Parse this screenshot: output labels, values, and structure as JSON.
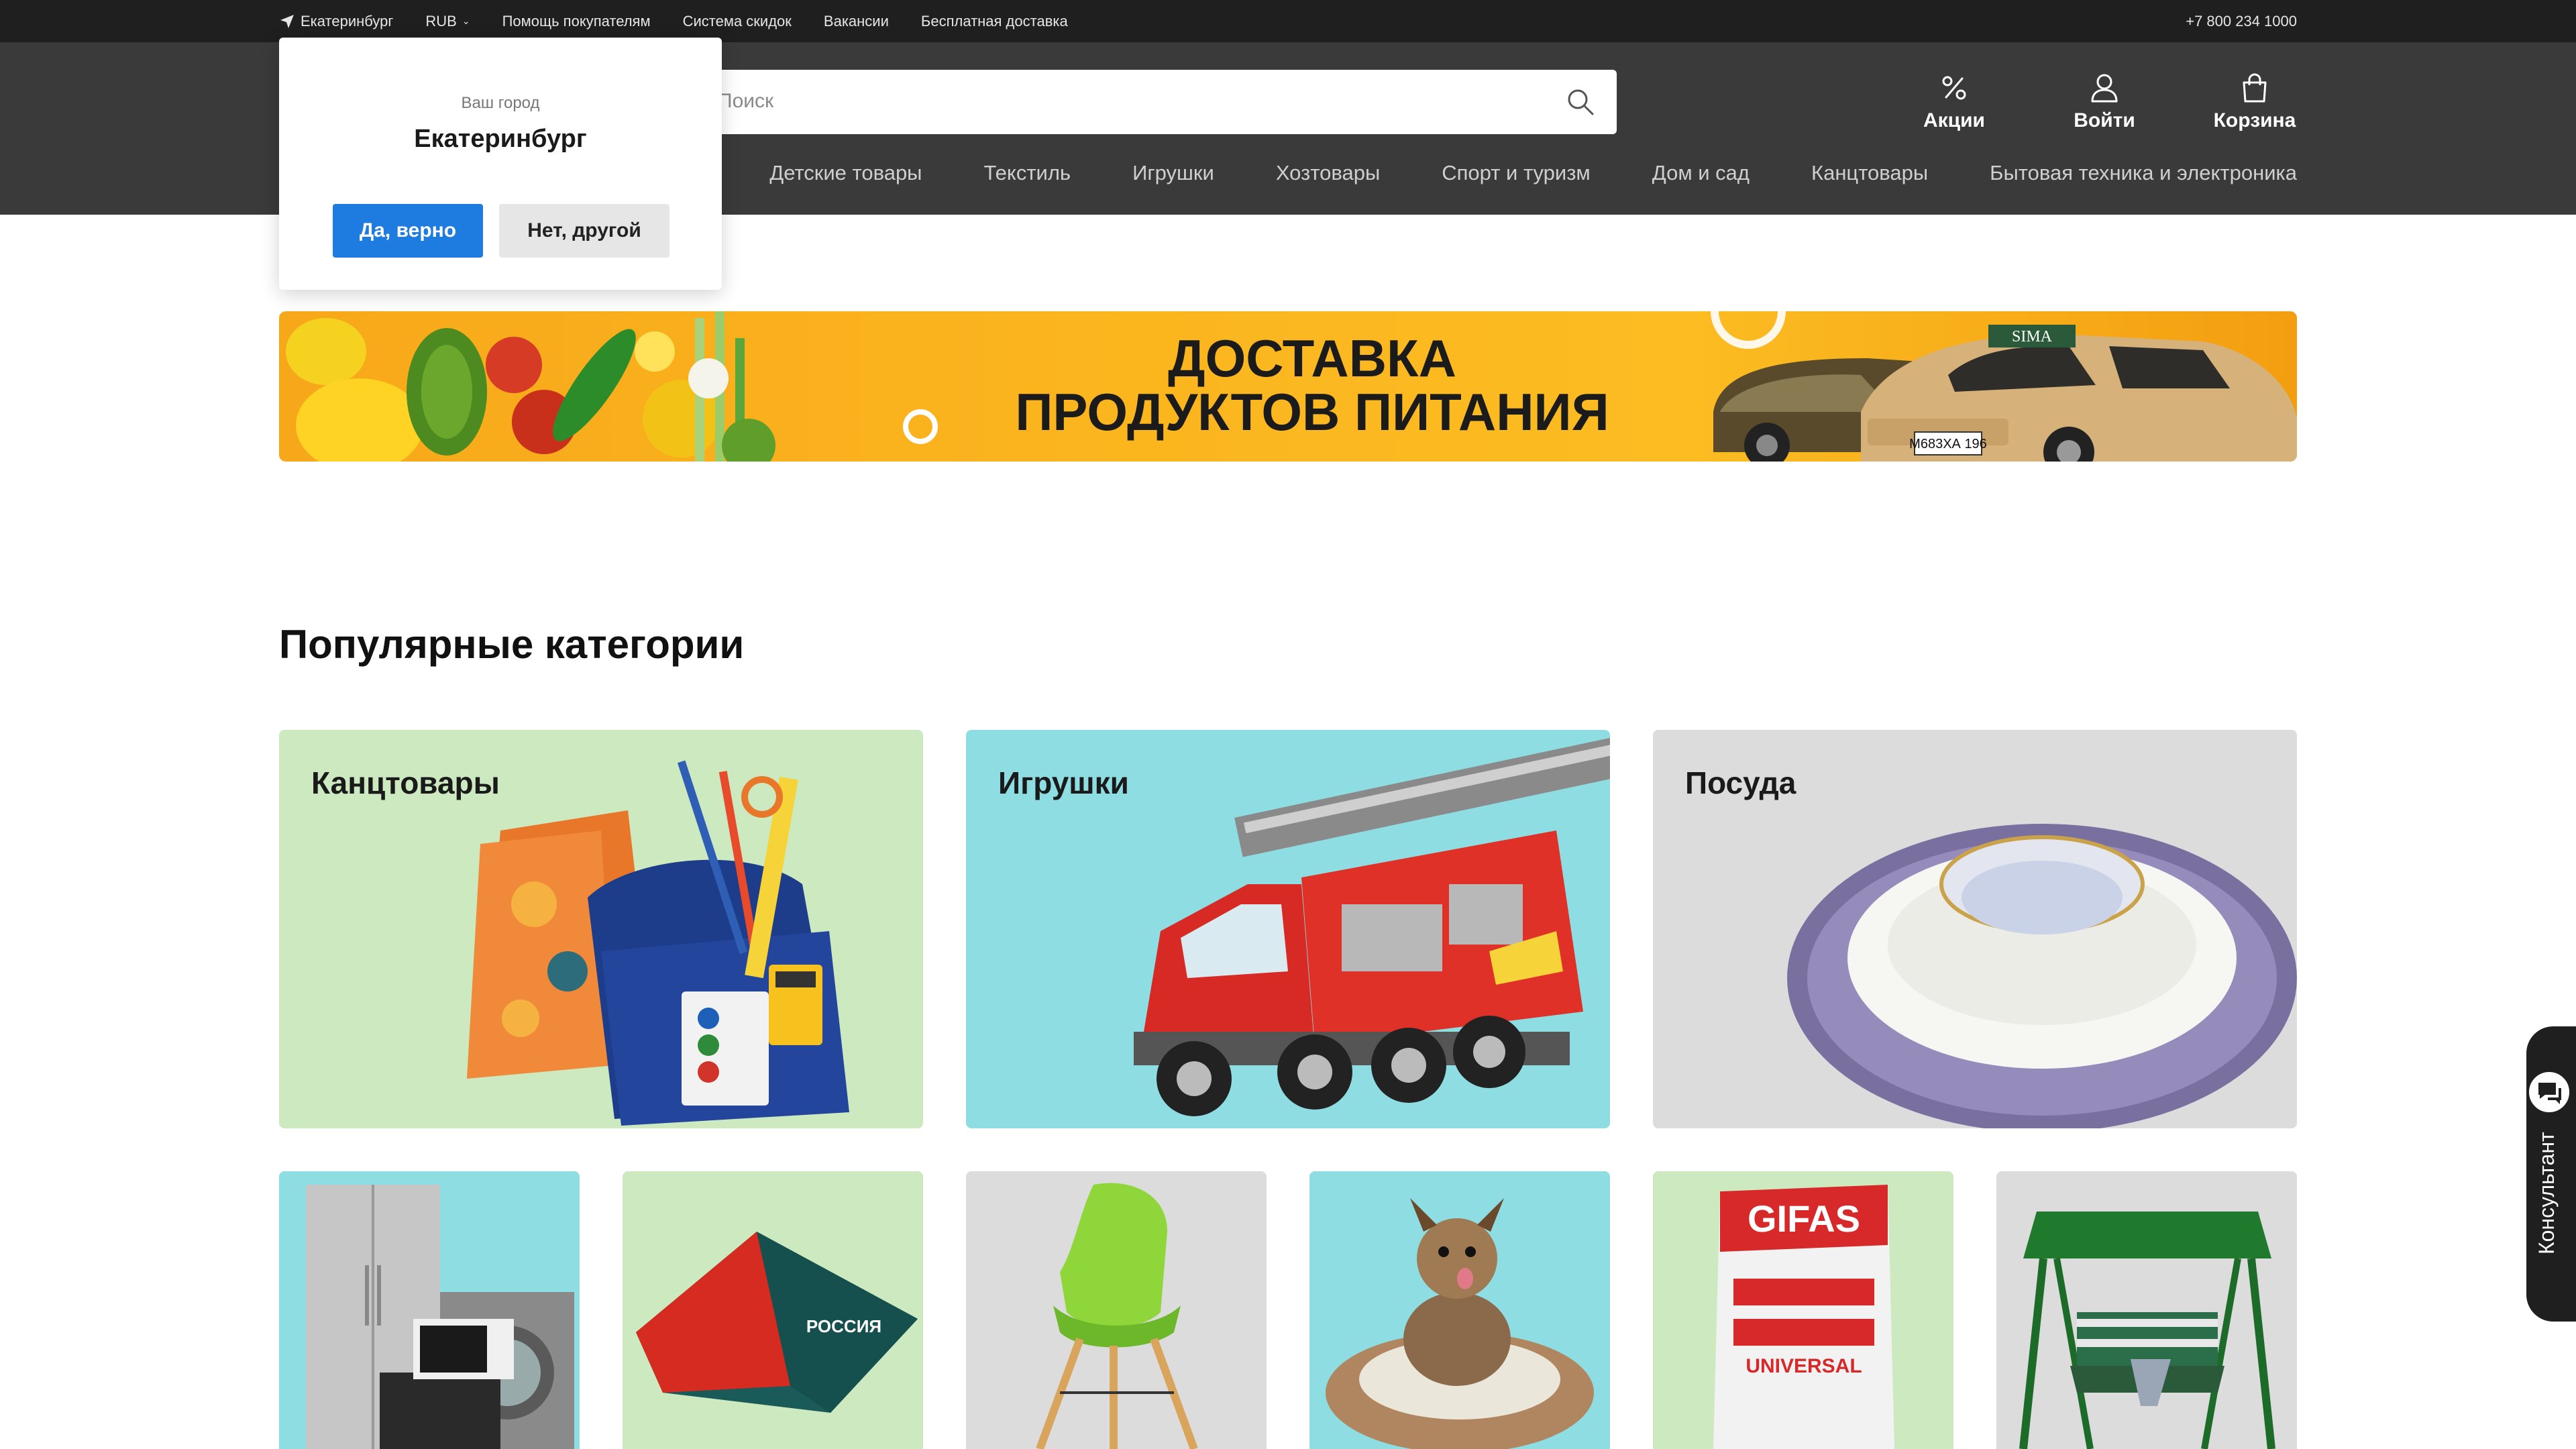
{
  "topbar": {
    "city": "Екатеринбург",
    "currency": "RUB",
    "links": [
      "Помощь покупателям",
      "Система скидок",
      "Вакансии",
      "Бесплатная доставка"
    ],
    "phone": "+7 800 234 1000"
  },
  "header": {
    "search_placeholder": "Поиск",
    "actions": {
      "sales": "Акции",
      "login": "Войти",
      "cart": "Корзина"
    },
    "nav": [
      "Детские товары",
      "Текстиль",
      "Игрушки",
      "Хозтовары",
      "Спорт и туризм",
      "Дом и сад",
      "Канцтовары",
      "Бытовая техника и электроника"
    ]
  },
  "city_popup": {
    "caption": "Ваш город",
    "city": "Екатеринбург",
    "yes": "Да, верно",
    "no": "Нет, другой"
  },
  "banner": {
    "line1": "ДОСТАВКА",
    "line2": "ПРОДУКТОВ ПИТАНИЯ",
    "car_brand": "SIMA",
    "plate": "М683ХА 196"
  },
  "popular": {
    "title": "Популярные категории",
    "big_cards": [
      {
        "label": "Канцтовары",
        "bg": "#cde9c0"
      },
      {
        "label": "Игрушки",
        "bg": "#8edde2"
      },
      {
        "label": "Посуда",
        "bg": "#dcdcdc"
      }
    ],
    "small_card_colors": [
      "#8edde2",
      "#cde9c0",
      "#dcdcdc",
      "#8edde2",
      "#cde9c0",
      "#dcdcdc"
    ],
    "tent_text": "РОССИЯ",
    "bag_brand": "GIFAS",
    "bag_text": "UNIVERSAL"
  },
  "consultant": {
    "label": "Консультант"
  },
  "colors": {
    "primary_button": "#1e7be0",
    "header_bg": "#3a3a3a",
    "topbar_bg": "#1f1f1f"
  }
}
